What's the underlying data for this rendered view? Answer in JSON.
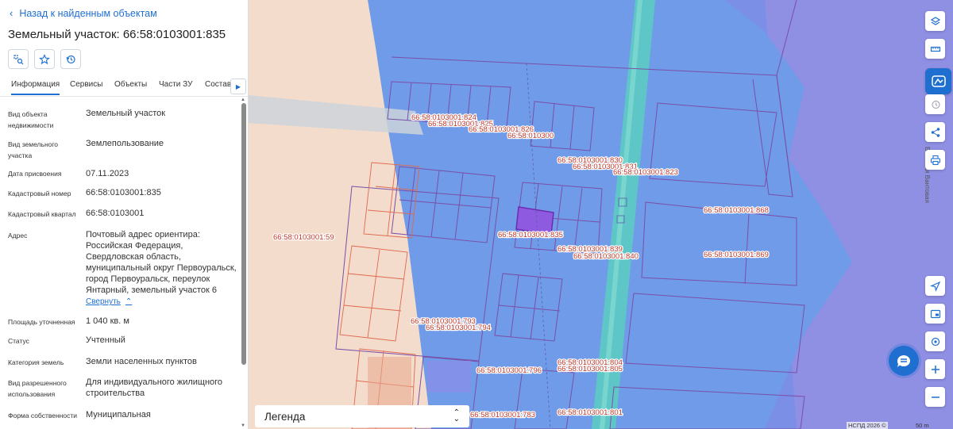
{
  "panel": {
    "back_label": "Назад к найденным объектам",
    "title": "Земельный участок: 66:58:0103001:835",
    "tabs": [
      "Информация",
      "Сервисы",
      "Объекты",
      "Части ЗУ",
      "Состав"
    ],
    "active_tab": "Информация",
    "rows": [
      {
        "label": "Вид объекта недвижимости",
        "value": "Земельный участок"
      },
      {
        "label": "Вид земельного участка",
        "value": "Землепользование"
      },
      {
        "label": "Дата присвоения",
        "value": "07.11.2023"
      },
      {
        "label": "Кадастровый номер",
        "value": "66:58:0103001:835"
      },
      {
        "label": "Кадастровый квартал",
        "value": "66:58:0103001"
      },
      {
        "label": "Адрес",
        "value": "Почтовый адрес ориентира: Российская Федерация, Свердловская область, муниципальный округ Первоуральск, город Первоуральск, переулок Янтарный, земельный участок 6"
      },
      {
        "label": "Площадь уточненная",
        "value": "1 040 кв. м"
      },
      {
        "label": "Статус",
        "value": "Учтенный"
      },
      {
        "label": "Категория земель",
        "value": "Земли населенных пунктов"
      },
      {
        "label": "Вид разрешенного использования",
        "value": "Для индивидуального жилищного строительства"
      },
      {
        "label": "Форма собственности",
        "value": "Муниципальная"
      }
    ],
    "collapse_label": "Свернуть"
  },
  "map": {
    "labels": [
      "66:58:0103001:824",
      "66:58:0103001:825",
      "66:58:0103001:826",
      "66:58:010300",
      "66:58:0103001:830",
      "66:58:0103001:831",
      "66:58:0103001:823",
      "66:58:0103001:868",
      "66:58:0103001:59",
      "66:58:0103001:835",
      "66:58:0103001:839",
      "66:58:0103001:840",
      "66:58:0103001:869",
      "66:58:0103001:793",
      "66:58:0103001:794",
      "66:58:0103001:796",
      "66:58:0103001:804",
      "66:58:0103001:805",
      "66:58:0103001:783",
      "66:58:0103001:801"
    ],
    "street_label": "Большая Вантовая",
    "legend_label": "Легенда",
    "attribution": "НСПД 2026 ©",
    "scale_label": "50 m",
    "colors": {
      "water": "#6f9be8",
      "zone": "#7b8fe6",
      "sand": "#f3dccb",
      "road": "#5fc6c8",
      "parcel_outline": "#7a4fa8",
      "selected": "#8e5be0"
    }
  },
  "toolbar": {
    "icons": [
      "layers-icon",
      "ruler-icon",
      "map-service-icon",
      "history-icon",
      "share-icon",
      "print-icon",
      "navigation-icon",
      "screen-icon",
      "location-icon",
      "zoom-in-icon",
      "zoom-out-icon",
      "chat-icon"
    ]
  }
}
